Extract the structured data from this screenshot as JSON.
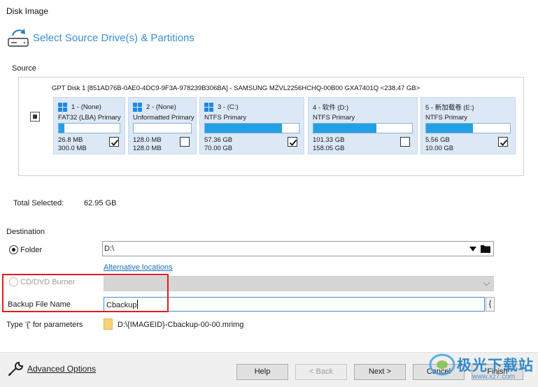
{
  "window": {
    "title": "Disk Image"
  },
  "header": {
    "title": "Select Source Drive(s) & Partitions",
    "icon": "disk-image-icon"
  },
  "source": {
    "label": "Source",
    "disk_label": "GPT Disk 1 [851AD76B-0AE0-4DC9-9F3A-978239B306BA] - SAMSUNG MZVL2256HCHQ-00B00 GXA7401Q  <238.47 GB>",
    "partitions": [
      {
        "name": "1 -  (None)",
        "type": "FAT32 (LBA) Primary",
        "used": "26.8 MB",
        "total": "300.0 MB",
        "fill": 0.09,
        "checked": true,
        "os_icon": true
      },
      {
        "name": "2 -  (None)",
        "type": "Unformatted Primary",
        "used": "128.0 MB",
        "total": "128.0 MB",
        "fill": 0.0,
        "checked": false,
        "os_icon": true
      },
      {
        "name": "3 -  (C:)",
        "type": "NTFS Primary",
        "used": "57.36 GB",
        "total": "70.00 GB",
        "fill": 0.82,
        "checked": true,
        "os_icon": true
      },
      {
        "name": "4 - 软件 (D:)",
        "type": "NTFS Primary",
        "used": "101.33 GB",
        "total": "158.05 GB",
        "fill": 0.64,
        "checked": false,
        "os_icon": false
      },
      {
        "name": "5 - 新加载卷 (E:)",
        "type": "NTFS Primary",
        "used": "5.56 GB",
        "total": "10.00 GB",
        "fill": 0.56,
        "checked": true,
        "os_icon": false
      }
    ]
  },
  "total_selected": {
    "label": "Total Selected:",
    "value": "62.95 GB"
  },
  "destination": {
    "label": "Destination",
    "folder_label": "Folder",
    "folder_value": "D:\\",
    "alternative_locations": "Alternative locations",
    "cd_label": "CD/DVD Burner",
    "backup_file_name_label": "Backup File Name",
    "backup_file_name_value": "Cbackup",
    "brace_button": "{",
    "type_hint": "Type '{' for parameters",
    "resulting_path": "D:\\{IMAGEID}-Cbackup-00-00.mrimg"
  },
  "footer": {
    "advanced_options": "Advanced Options",
    "help": "Help",
    "back": "< Back",
    "next": "Next >",
    "cancel": "Cancel",
    "finish": "Finish"
  },
  "watermark": {
    "text": "极光下载站",
    "sub": "www.xz7.com"
  },
  "colors": {
    "accent": "#3d8ecf",
    "fill": "#22a0e6",
    "partition_bg": "#dce8f6",
    "highlight": "#e21b1b"
  }
}
